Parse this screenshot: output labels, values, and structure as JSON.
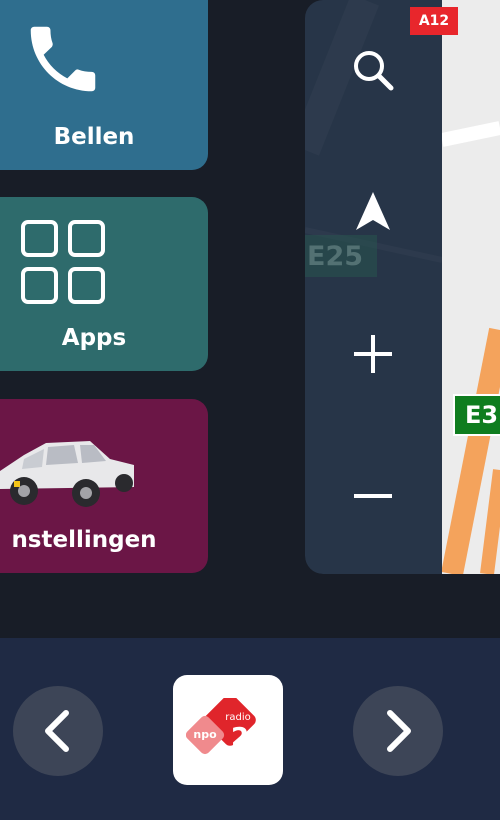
{
  "tiles": {
    "phone": {
      "label": "Bellen",
      "color": "#2f6e8e"
    },
    "apps": {
      "label": "Apps",
      "color": "#2e6b6c"
    },
    "settings": {
      "label": "nstellingen",
      "color": "#6b1646"
    }
  },
  "map": {
    "controls": [
      "search-icon",
      "navigation-arrow-icon",
      "zoom-in-icon",
      "zoom-out-icon"
    ],
    "road_labels": {
      "a12": "A12",
      "e25": "E25",
      "e3": "E3"
    }
  },
  "bottom_bar": {
    "prev_icon": "chevron-left-icon",
    "next_icon": "chevron-right-icon",
    "radio_logo": {
      "npo": "npo",
      "radio": "radio",
      "number": "2"
    }
  }
}
